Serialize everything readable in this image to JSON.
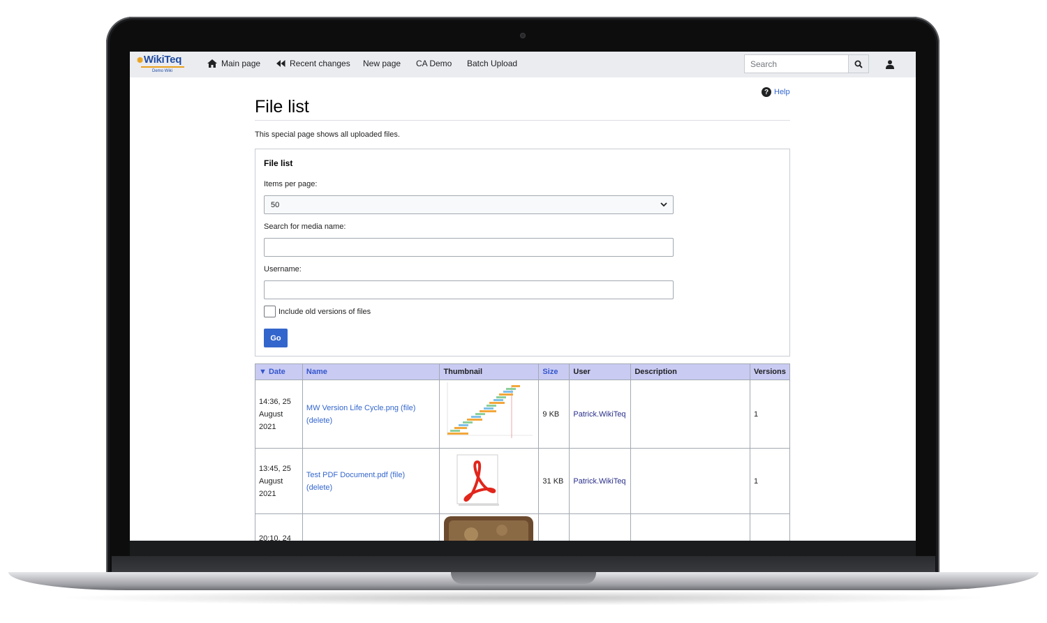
{
  "logo": {
    "word": "WikiTeq",
    "sub": "Demo Wiki"
  },
  "nav": {
    "main_page": "Main page",
    "recent_changes": "Recent changes",
    "new_page": "New page",
    "ca_demo": "CA Demo",
    "batch_upload": "Batch Upload"
  },
  "search": {
    "placeholder": "Search"
  },
  "page": {
    "help": "Help",
    "title": "File list",
    "intro": "This special page shows all uploaded files."
  },
  "form": {
    "legend": "File list",
    "items_per_page_label": "Items per page:",
    "items_per_page_value": "50",
    "media_name_label": "Search for media name:",
    "username_label": "Username:",
    "include_old_label": "Include old versions of files",
    "go_label": "Go"
  },
  "table": {
    "headers": {
      "date": "▼ Date",
      "name": "Name",
      "thumbnail": "Thumbnail",
      "size": "Size",
      "user": "User",
      "description": "Description",
      "versions": "Versions"
    },
    "rows": [
      {
        "date_time": "14:36, 25",
        "date_month": "August",
        "date_year": "2021",
        "name": "MW Version Life Cycle.png",
        "file": "(file)",
        "delete": "(delete)",
        "size": "9 KB",
        "user": "Patrick.WikiTeq",
        "description": "",
        "versions": "1"
      },
      {
        "date_time": "13:45, 25",
        "date_month": "August",
        "date_year": "2021",
        "name": "Test PDF Document.pdf",
        "file": "(file)",
        "delete": "(delete)",
        "size": "31 KB",
        "user": "Patrick.WikiTeq",
        "description": "",
        "versions": "1"
      },
      {
        "date_time": "20:10, 24",
        "date_month": "",
        "date_year": "",
        "name": "",
        "file": "",
        "delete": "",
        "size": "",
        "user": "",
        "description": "",
        "versions": ""
      }
    ]
  },
  "colors": {
    "accent": "#3366cc",
    "header_bg": "#c9cbf3",
    "topbar_bg": "#eaecf0"
  }
}
